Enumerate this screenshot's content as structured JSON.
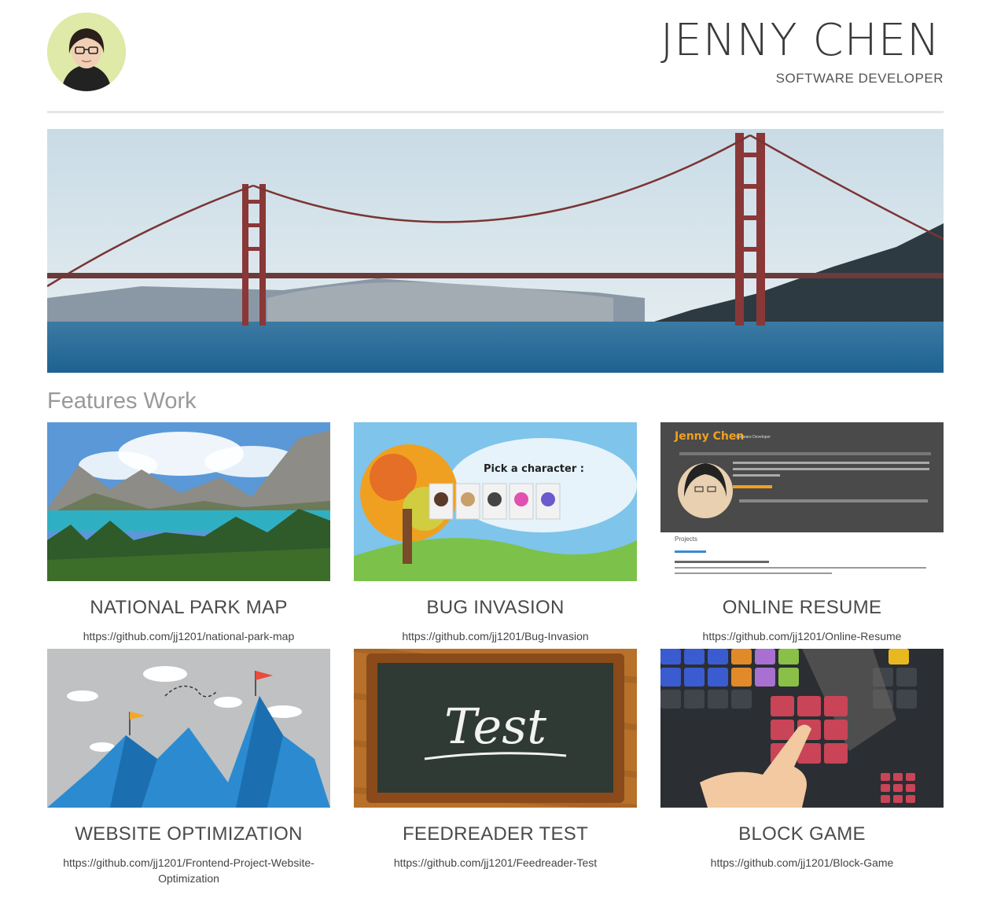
{
  "header": {
    "name": "JENNY CHEN",
    "role": "SOFTWARE DEVELOPER"
  },
  "section": {
    "title": "Features Work"
  },
  "projects": [
    {
      "title": "NATIONAL PARK MAP",
      "url": "https://github.com/jj1201/national-park-map"
    },
    {
      "title": "BUG INVASION",
      "url": "https://github.com/jj1201/Bug-Invasion"
    },
    {
      "title": "ONLINE RESUME",
      "url": "https://github.com/jj1201/Online-Resume"
    },
    {
      "title": "WEBSITE OPTIMIZATION",
      "url": "https://github.com/jj1201/Frontend-Project-Website-Optimization"
    },
    {
      "title": "FEEDREADER TEST",
      "url": "https://github.com/jj1201/Feedreader-Test"
    },
    {
      "title": "BLOCK GAME",
      "url": "https://github.com/jj1201/Block-Game"
    }
  ],
  "thumb_text": {
    "bug_prompt": "Pick a character :",
    "resume_name": "Jenny Chen",
    "resume_role": "Software Developer",
    "resume_projects": "Projects",
    "chalk": "Test"
  }
}
